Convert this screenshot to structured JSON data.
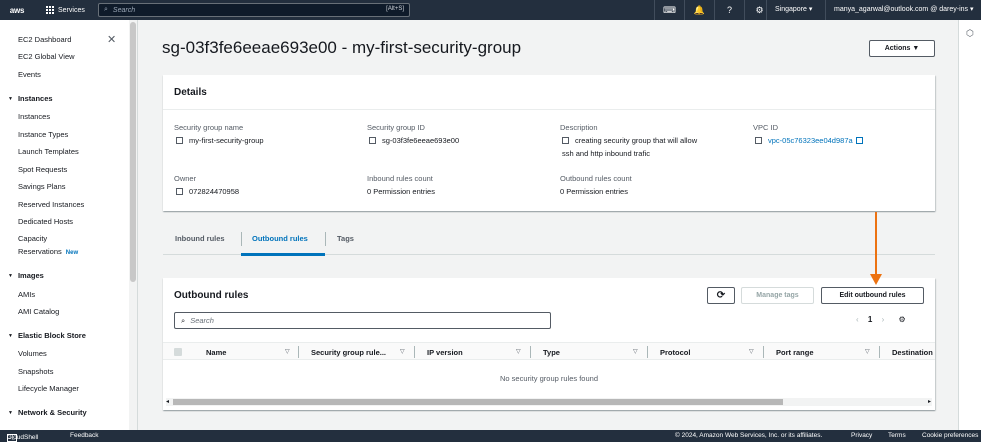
{
  "topbar": {
    "logo": "aws",
    "services": "Services",
    "search_placeholder": "Search",
    "shortcut": "[Alt+S]",
    "region": "Singapore ▾",
    "account": "manya_agarwal@outlook.com @ darey-ins ▾"
  },
  "sidebar": {
    "top_links": [
      "EC2 Dashboard",
      "EC2 Global View",
      "Events"
    ],
    "sections": [
      {
        "title": "Instances",
        "items": [
          "Instances",
          "Instance Types",
          "Launch Templates",
          "Spot Requests",
          "Savings Plans",
          "Reserved Instances",
          "Dedicated Hosts",
          "Capacity"
        ]
      },
      {
        "title": "Images",
        "items": [
          "AMIs",
          "AMI Catalog"
        ]
      },
      {
        "title": "Elastic Block Store",
        "items": [
          "Volumes",
          "Snapshots",
          "Lifecycle Manager"
        ]
      },
      {
        "title": "Network & Security",
        "items": []
      }
    ],
    "cap_res": "Reservations",
    "new_badge": "New"
  },
  "page": {
    "title": "sg-03f3fe6eeae693e00 - my-first-security-group",
    "actions": "Actions ▼"
  },
  "details": {
    "heading": "Details",
    "fields": [
      {
        "label": "Security group name",
        "value": "my-first-security-group"
      },
      {
        "label": "Security group ID",
        "value": "sg-03f3fe6eeae693e00"
      },
      {
        "label": "Description",
        "value": "creating security group that will allow",
        "value2": "ssh and http inbound trafic"
      },
      {
        "label": "VPC ID",
        "value": "vpc-05c76323ee04d987a"
      },
      {
        "label": "Owner",
        "value": "072824470958"
      },
      {
        "label": "Inbound rules count",
        "value": "0 Permission entries"
      },
      {
        "label": "Outbound rules count",
        "value": "0 Permission entries"
      }
    ]
  },
  "tabs": [
    "Inbound rules",
    "Outbound rules",
    "Tags"
  ],
  "outbound": {
    "heading": "Outbound rules",
    "manage_tags": "Manage tags",
    "edit": "Edit outbound rules",
    "search_placeholder": "Search",
    "page": "1",
    "columns": [
      "Name",
      "Security group rule...",
      "IP version",
      "Type",
      "Protocol",
      "Port range",
      "Destination"
    ],
    "empty": "No security group rules found"
  },
  "footer": {
    "cloudshell": "CloudShell",
    "feedback": "Feedback",
    "copyright": "© 2024, Amazon Web Services, Inc. or its affiliates.",
    "privacy": "Privacy",
    "terms": "Terms",
    "cookies": "Cookie preferences"
  },
  "colors": {
    "accent": "#0073bb",
    "annotation_arrow": "#ec7211",
    "topbar": "#232f3e"
  }
}
